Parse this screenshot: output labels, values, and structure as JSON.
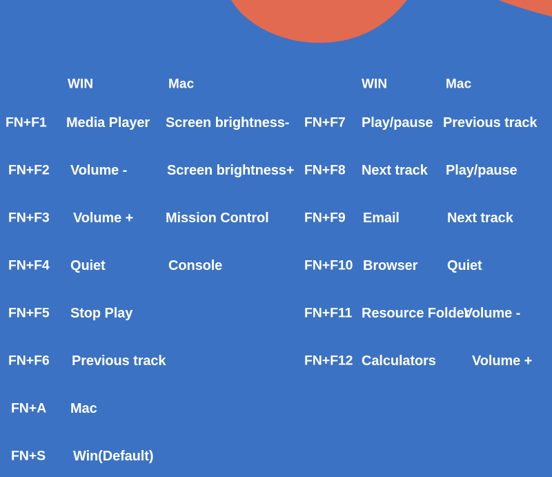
{
  "theme": {
    "background_color": "#3b72c4",
    "accent_color": "#e26a50",
    "text_color": "#ffffff"
  },
  "decor": {
    "top_center_blob_name": "orange-wave-center",
    "top_right_wedge_name": "orange-wave-right"
  },
  "tables": [
    {
      "id": "left",
      "headers": {
        "key": "",
        "win": "WIN",
        "mac": "Mac"
      },
      "rows": [
        {
          "key": "FN+F1",
          "win": "Media Player",
          "mac": "Screen brightness-"
        },
        {
          "key": "FN+F2",
          "win": "Volume -",
          "mac": "Screen brightness+"
        },
        {
          "key": "FN+F3",
          "win": "Volume +",
          "mac": "Mission Control"
        },
        {
          "key": "FN+F4",
          "win": "Quiet",
          "mac": "Console"
        },
        {
          "key": "FN+F5",
          "win": "Stop Play",
          "mac": ""
        },
        {
          "key": "FN+F6",
          "win": "Previous track",
          "mac": ""
        },
        {
          "key": "FN+A",
          "win": "Mac",
          "mac": ""
        },
        {
          "key": "FN+S",
          "win": "Win(Default)",
          "mac": ""
        }
      ]
    },
    {
      "id": "right",
      "headers": {
        "key": "",
        "win": "WIN",
        "mac": "Mac"
      },
      "rows": [
        {
          "key": "FN+F7",
          "win": "Play/pause",
          "mac": "Previous track"
        },
        {
          "key": "FN+F8",
          "win": "Next track",
          "mac": "Play/pause"
        },
        {
          "key": "FN+F9",
          "win": "Email",
          "mac": "Next track"
        },
        {
          "key": "FN+F10",
          "win": "Browser",
          "mac": "Quiet"
        },
        {
          "key": "FN+F11",
          "win": "Resource Folder",
          "mac": "Volume -"
        },
        {
          "key": "FN+F12",
          "win": "Calculators",
          "mac": "Volume +"
        }
      ]
    }
  ]
}
